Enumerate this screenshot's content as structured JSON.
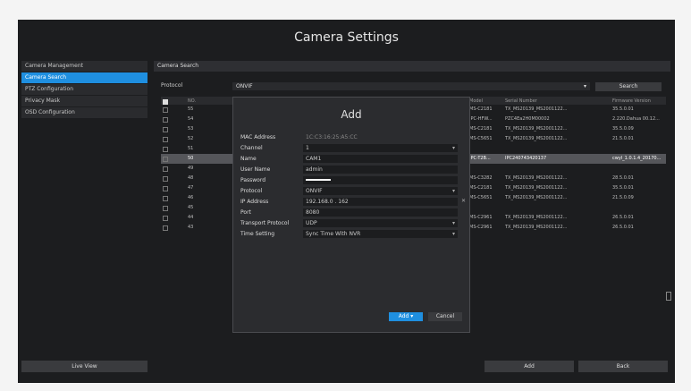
{
  "header": {
    "title": "Camera Settings"
  },
  "sidebar": {
    "items": [
      {
        "label": "Camera Management"
      },
      {
        "label": "Camera Search"
      },
      {
        "label": "PTZ Configuration"
      },
      {
        "label": "Privacy Mask"
      },
      {
        "label": "OSD Configuration"
      }
    ],
    "live_view_label": "Live View"
  },
  "main": {
    "section_title": "Camera Search",
    "protocol_label": "Protocol",
    "protocol_value": "ONVIF",
    "search_label": "Search",
    "table": {
      "headers": {
        "no": "NO.",
        "model": "Model",
        "serial": "Serial Number",
        "fw": "Firmware Version"
      },
      "rows": [
        {
          "no": "55",
          "model": "MS-C2181",
          "serial": "TX_MS20139_MS2001122...",
          "fw": "35.5.0.01"
        },
        {
          "no": "54",
          "model": "IPC-HFW...",
          "serial": "PZC4Ea2H0M00002",
          "fw": "2.220.Dahua 00.12..."
        },
        {
          "no": "53",
          "model": "MS-C2181",
          "serial": "TX_MS20139_MS2001122...",
          "fw": "35.5.0.09"
        },
        {
          "no": "52",
          "model": "MS-C5651",
          "serial": "TX_MS20139_MS2001122...",
          "fw": "21.5.0.01"
        },
        {
          "no": "51",
          "model": "",
          "serial": "",
          "fw": ""
        },
        {
          "no": "50",
          "model": "IPC-T2B...",
          "serial": "IPC240743420137",
          "fw": "cwyl_1.0.1.4_20170..."
        },
        {
          "no": "49",
          "model": "",
          "serial": "",
          "fw": ""
        },
        {
          "no": "48",
          "model": "MS-C3282",
          "serial": "TX_MS20139_MS2001122...",
          "fw": "28.5.0.01"
        },
        {
          "no": "47",
          "model": "MS-C2181",
          "serial": "TX_MS20139_MS2001122...",
          "fw": "35.5.0.01"
        },
        {
          "no": "46",
          "model": "MS-C5651",
          "serial": "TX_MS20139_MS2001122...",
          "fw": "21.5.0.09"
        },
        {
          "no": "45",
          "model": "",
          "serial": "",
          "fw": ""
        },
        {
          "no": "44",
          "model": "MS-C2961",
          "serial": "TX_MS20139_MS2001122...",
          "fw": "26.5.0.01"
        },
        {
          "no": "43",
          "model": "MS-C2961",
          "serial": "TX_MS20139_MS2001122...",
          "fw": "26.5.0.01"
        }
      ]
    },
    "add_label": "Add",
    "back_label": "Back"
  },
  "modal": {
    "title": "Add",
    "fields": {
      "mac": {
        "label": "MAC Address",
        "value": "1C:C3:16:25:A5:CC"
      },
      "channel": {
        "label": "Channel",
        "value": "1"
      },
      "name": {
        "label": "Name",
        "value": "CAM1"
      },
      "username": {
        "label": "User Name",
        "value": "admin"
      },
      "password": {
        "label": "Password",
        "value": ""
      },
      "protocol": {
        "label": "Protocol",
        "value": "ONVIF"
      },
      "ip": {
        "label": "IP Address",
        "value": "192.168.0 . 162"
      },
      "port": {
        "label": "Port",
        "value": "8080"
      },
      "transport": {
        "label": "Transport Protocol",
        "value": "UDP"
      },
      "time": {
        "label": "Time Setting",
        "value": "Sync Time With NVR"
      }
    },
    "add_label": "Add",
    "cancel_label": "Cancel"
  },
  "colors": {
    "accent": "#1f8fe0",
    "background": "#1c1d1f"
  }
}
